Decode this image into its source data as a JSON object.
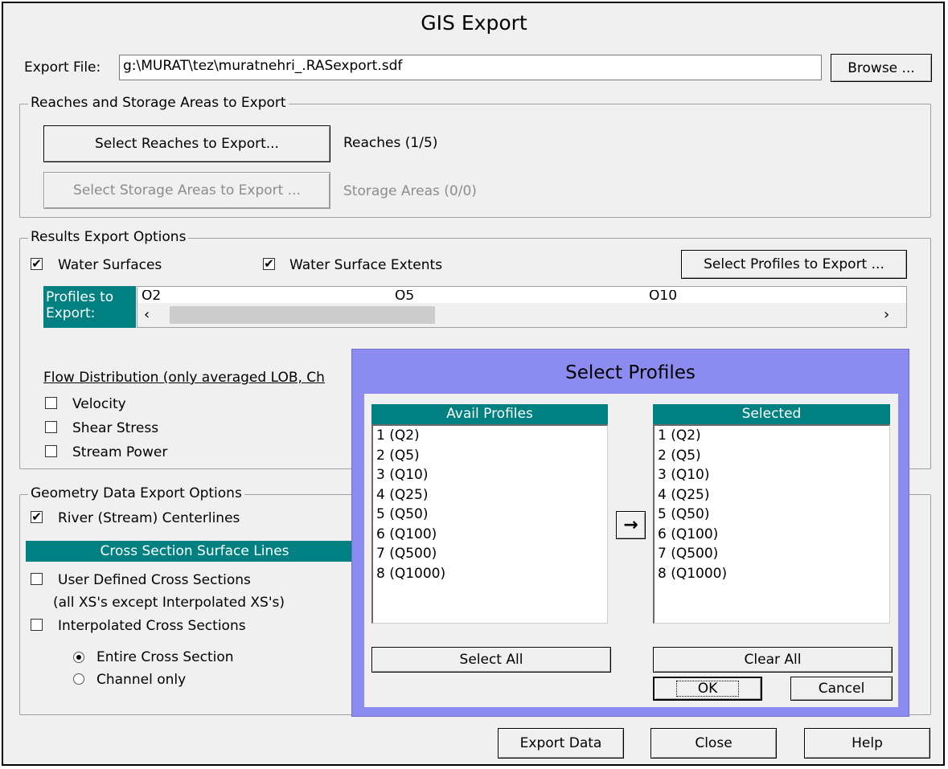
{
  "window": {
    "title": "GIS Export"
  },
  "export_file": {
    "label": "Export File:",
    "value": "g:\\MURAT\\tez\\muratnehri_.RASexport.sdf",
    "browse_label": "Browse ..."
  },
  "reaches": {
    "group_title": "Reaches and Storage Areas to Export",
    "select_reaches_label": "Select Reaches to Export...",
    "reaches_count": "Reaches (1/5)",
    "select_storage_label": "Select Storage Areas to Export ...",
    "storage_count": "Storage Areas (0/0)"
  },
  "results": {
    "group_title": "Results Export Options",
    "water_surfaces": {
      "label": "Water Surfaces",
      "checked": true
    },
    "water_surface_extents": {
      "label": "Water Surface Extents",
      "checked": true
    },
    "select_profiles_label": "Select Profiles to Export ...",
    "profiles_header": "Profiles to Export:",
    "profiles_values": [
      "Q2",
      "Q5",
      "Q10"
    ],
    "flow_distribution_label": "Flow Distribution (only averaged LOB, Ch",
    "velocity": {
      "label": "Velocity",
      "checked": false
    },
    "shear_stress": {
      "label": "Shear Stress",
      "checked": false
    },
    "stream_power": {
      "label": "Stream Power",
      "checked": false
    }
  },
  "geometry": {
    "group_title": "Geometry Data Export Options",
    "centerlines": {
      "label": "River (Stream) Centerlines",
      "checked": true
    },
    "xs_header": "Cross Section Surface Lines",
    "user_defined": {
      "label": "User Defined Cross Sections",
      "checked": false
    },
    "user_defined_note": "(all XS's except Interpolated XS's)",
    "interpolated": {
      "label": "Interpolated Cross Sections",
      "checked": false
    },
    "entire_xs": {
      "label": "Entire Cross Section",
      "selected": true
    },
    "channel_only": {
      "label": "Channel only",
      "selected": false
    }
  },
  "footer": {
    "export_label": "Export Data",
    "close_label": "Close",
    "help_label": "Help"
  },
  "select_profiles_dialog": {
    "title": "Select Profiles",
    "avail_header": "Avail Profiles",
    "selected_header": "Selected",
    "avail_items": [
      "1 (Q2)",
      "2 (Q5)",
      "3 (Q10)",
      "4 (Q25)",
      "5 (Q50)",
      "6 (Q100)",
      "7 (Q500)",
      "8 (Q1000)"
    ],
    "selected_items": [
      "1 (Q2)",
      "2 (Q5)",
      "3 (Q10)",
      "4 (Q25)",
      "5 (Q50)",
      "6 (Q100)",
      "7 (Q500)",
      "8 (Q1000)"
    ],
    "arrow_glyph": "→",
    "select_all_label": "Select All",
    "clear_all_label": "Clear All",
    "ok_label": "OK",
    "cancel_label": "Cancel"
  },
  "colors": {
    "teal": "#008080",
    "dialog_border": "#8c8cf0",
    "face": "#f0f0f0"
  }
}
